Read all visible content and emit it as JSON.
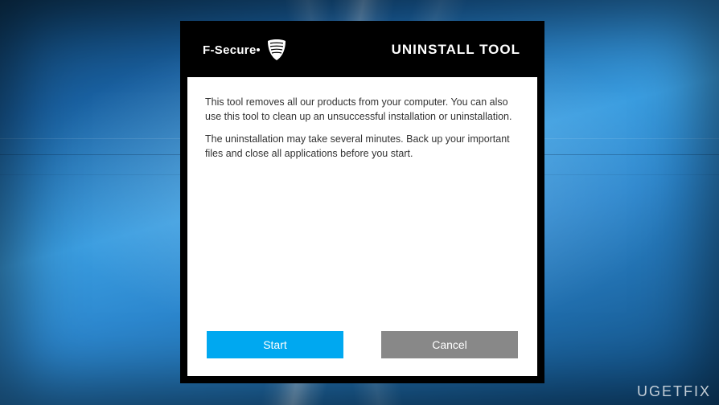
{
  "header": {
    "brand": "F-Secure",
    "title": "UNINSTALL TOOL"
  },
  "body": {
    "paragraph1": "This tool removes all our products from your computer. You can also use this tool to clean up an unsuccessful installation or uninstallation.",
    "paragraph2": "The uninstallation may take several minutes. Back up your important files and close all applications before you start."
  },
  "buttons": {
    "start": "Start",
    "cancel": "Cancel"
  },
  "watermark": "UGETFIX",
  "colors": {
    "primary": "#00a8f0",
    "secondary": "#888888"
  }
}
